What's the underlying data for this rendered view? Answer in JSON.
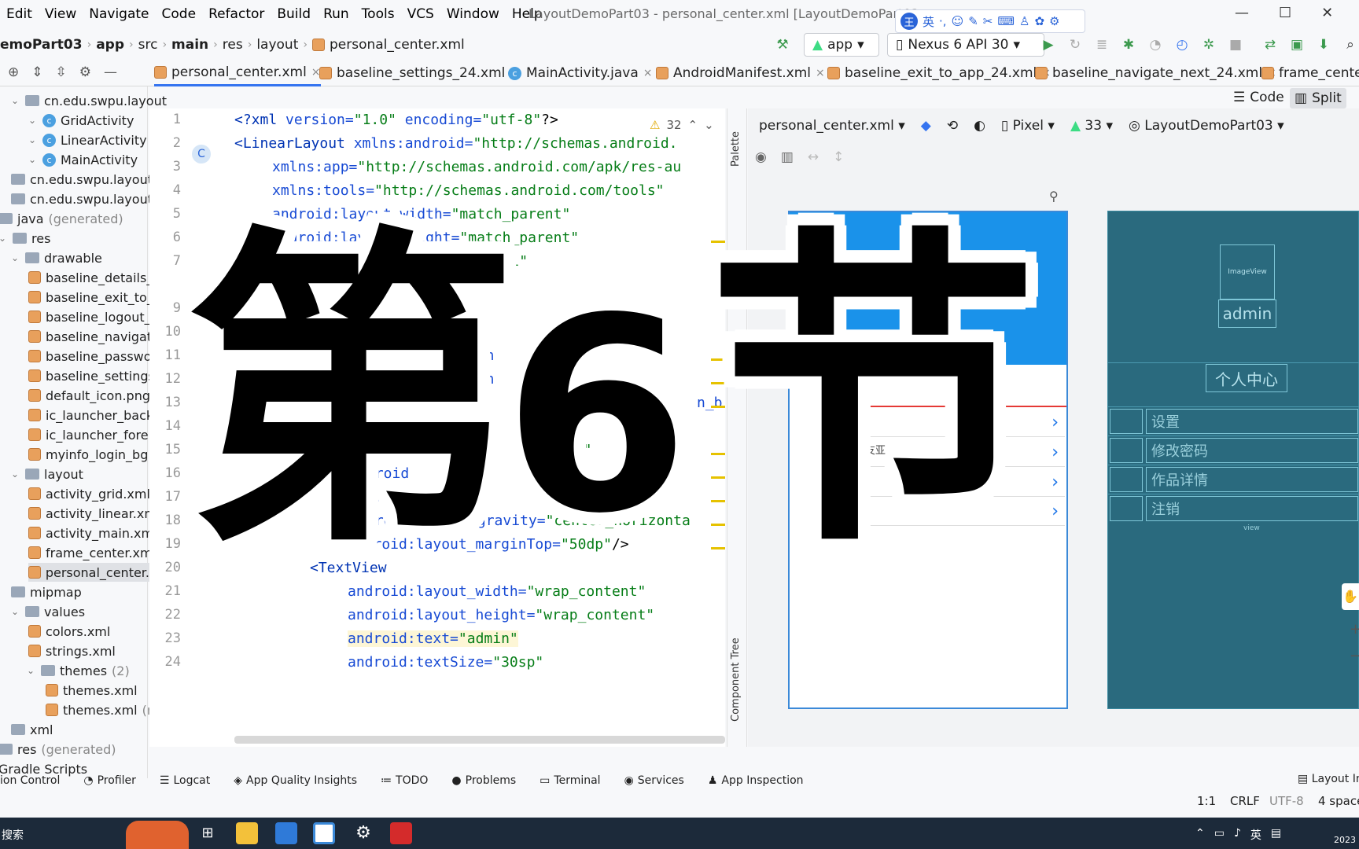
{
  "menu": [
    "Edit",
    "View",
    "Navigate",
    "Code",
    "Refactor",
    "Build",
    "Run",
    "Tools",
    "VCS",
    "Window",
    "Help"
  ],
  "window_title": "LayoutDemoPart03 - personal_center.xml [LayoutDemoPart03",
  "ime": {
    "wang": "王",
    "lang": "英"
  },
  "breadcrumb": [
    "emoPart03",
    "app",
    "src",
    "main",
    "res",
    "layout",
    "personal_center.xml"
  ],
  "run": {
    "config": "app",
    "device": "Nexus 6 API 30"
  },
  "tabs": [
    "personal_center.xml",
    "baseline_settings_24.xml",
    "MainActivity.java",
    "AndroidManifest.xml",
    "baseline_exit_to_app_24.xml",
    "baseline_navigate_next_24.xml",
    "frame_cente"
  ],
  "view_modes": {
    "code": "Code",
    "split": "Split"
  },
  "tree": [
    {
      "label": "cn.edu.swpu.layout"
    },
    {
      "label": "GridActivity"
    },
    {
      "label": "LinearActivity"
    },
    {
      "label": "MainActivity"
    },
    {
      "label": "cn.edu.swpu.layout"
    },
    {
      "label": "cn.edu.swpu.layout"
    },
    {
      "label": "java",
      "suffix": "(generated)"
    },
    {
      "label": "res"
    },
    {
      "label": "drawable"
    },
    {
      "label": "baseline_details_"
    },
    {
      "label": "baseline_exit_to_"
    },
    {
      "label": "baseline_logout_"
    },
    {
      "label": "baseline_navigat"
    },
    {
      "label": "baseline_passwo"
    },
    {
      "label": "baseline_settings"
    },
    {
      "label": "default_icon.png"
    },
    {
      "label": "ic_launcher_back"
    },
    {
      "label": "ic_launcher_fore"
    },
    {
      "label": "myinfo_login_bg"
    },
    {
      "label": "layout"
    },
    {
      "label": "activity_grid.xml"
    },
    {
      "label": "activity_linear.xm"
    },
    {
      "label": "activity_main.xm"
    },
    {
      "label": "frame_center.xm"
    },
    {
      "label": "personal_center."
    },
    {
      "label": "mipmap"
    },
    {
      "label": "values"
    },
    {
      "label": "colors.xml"
    },
    {
      "label": "strings.xml"
    },
    {
      "label": "themes",
      "suffix": "(2)"
    },
    {
      "label": "themes.xml"
    },
    {
      "label": "themes.xml",
      "suffix": "(r"
    },
    {
      "label": "xml"
    },
    {
      "label": "res",
      "suffix": "(generated)"
    },
    {
      "label": "Gradle Scripts"
    }
  ],
  "line_numbers": [
    "1",
    "2",
    "3",
    "4",
    "5",
    "6",
    "7",
    "9",
    "10",
    "11",
    "12",
    "13",
    "14",
    "15",
    "16",
    "17",
    "18",
    "19",
    "20",
    "21",
    "22",
    "23",
    "24"
  ],
  "code": [
    {
      "p": "<?xml ",
      "a": "version=",
      "v": "\"1.0\"",
      "a2": " encoding=",
      "v2": "\"utf-8\"",
      "e": "?>"
    },
    {
      "p": "<LinearLayout ",
      "a": "xmlns:android=",
      "v": "\"http://schemas.android."
    },
    {
      "a": "xmlns:app=",
      "v": "\"http://schemas.android.com/apk/res-au"
    },
    {
      "a": "xmlns:tools=",
      "v": "\"http://schemas.android.com/tools\""
    },
    {
      "a": "android:layout_width=",
      "v": "\"match_parent\""
    },
    {
      "a": "android:layout_height=",
      "v": "\"match_parent\""
    },
    {
      "a": "android:orientation=",
      "v": "\"vertical\""
    },
    {
      "a": "dth"
    },
    {
      "a": "igh"
    },
    {
      "a": "n_b"
    },
    {
      "v": "dp\""
    },
    {
      "a": "droid"
    },
    {
      "a": "droid"
    },
    {
      "a": "droid.layout_gravity=",
      "v": "\"center_horizonta"
    },
    {
      "a": "android:layout_marginTop=",
      "v": "\"50dp\"",
      "e": "/>"
    },
    {
      "p": "<TextView"
    },
    {
      "a": "android:layout_width=",
      "v": "\"wrap_content\""
    },
    {
      "a": "android:layout_height=",
      "v": "\"wrap_content\""
    },
    {
      "a": "android:text=",
      "v": "\"admin\""
    },
    {
      "a": "android:textSize=",
      "v": "\"30sp\""
    }
  ],
  "warnings": "32",
  "design_bar": {
    "file": "personal_center.xml",
    "device": "Pixel",
    "api": "33",
    "theme": "LayoutDemoPart03"
  },
  "phone_preview": {
    "text": "友亚"
  },
  "blueprint": {
    "image": "ImageView",
    "name": "admin",
    "title": "个人中心",
    "rows": [
      "设置",
      "修改密码",
      "作品详情",
      "注销"
    ],
    "view": "view"
  },
  "side_panels": {
    "palette": "Palette",
    "component_tree": "Component Tree"
  },
  "bottom_tools": [
    "ion Control",
    "Profiler",
    "Logcat",
    "App Quality Insights",
    "TODO",
    "Problems",
    "Terminal",
    "Services",
    "App Inspection",
    "Layout In"
  ],
  "status": {
    "pos": "1:1",
    "crlf": "CRLF",
    "enc": "UTF-8",
    "indent": "4 space"
  },
  "taskbar": {
    "search": "搜索",
    "clock_tail": "2023"
  },
  "overlay": {
    "c1": "第",
    "c2": "6",
    "c3": "节"
  },
  "colors": {
    "accent": "#3574f0",
    "phone_header": "#1a92ea",
    "blueprint": "#2a6a7e"
  }
}
